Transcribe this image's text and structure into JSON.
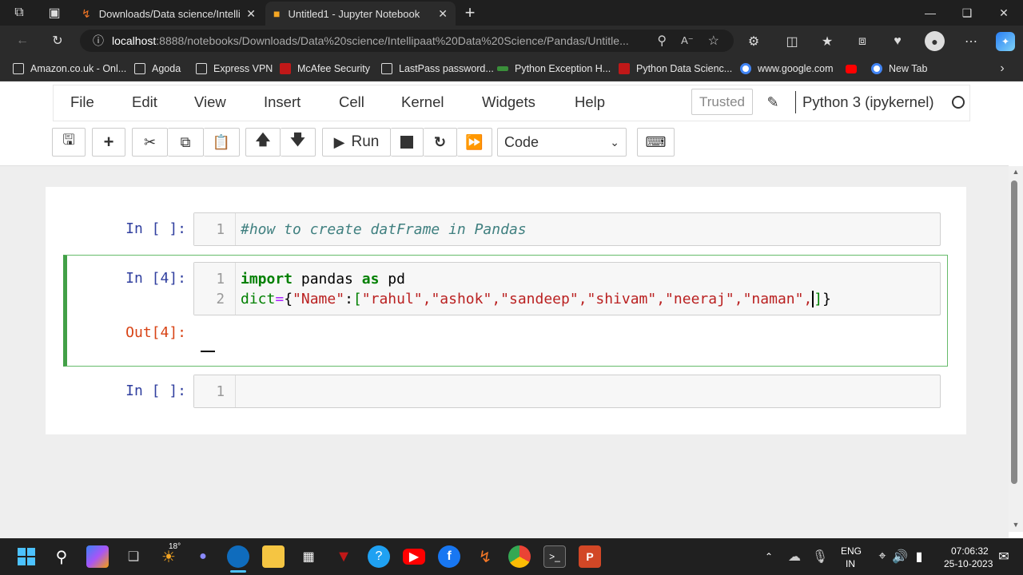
{
  "browser": {
    "tabs": [
      {
        "title": "Downloads/Data science/Intellipaat"
      },
      {
        "title": "Untitled1 - Jupyter Notebook"
      }
    ],
    "url": {
      "host": "localhost",
      "rest": ":8888/notebooks/Downloads/Data%20science/Intellipaat%20Data%20Science/Pandas/Untitle..."
    },
    "bookmarks": [
      {
        "label": "Amazon.co.uk - Onl...",
        "color": "#ffffff"
      },
      {
        "label": "Agoda",
        "color": "#ffffff"
      },
      {
        "label": "Express VPN",
        "color": "#ffffff"
      },
      {
        "label": "McAfee Security",
        "color": "#c01818"
      },
      {
        "label": "LastPass password...",
        "color": "#ffffff"
      },
      {
        "label": "Python Exception H...",
        "color": "#3a8f3a"
      },
      {
        "label": "Python Data Scienc...",
        "color": "#c01818"
      },
      {
        "label": "www.google.com",
        "color": "#4285f4"
      },
      {
        "label": "",
        "color": "#ff0000"
      },
      {
        "label": "New Tab",
        "color": "#4285f4"
      }
    ]
  },
  "jupyter": {
    "menu": [
      "File",
      "Edit",
      "View",
      "Insert",
      "Cell",
      "Kernel",
      "Widgets",
      "Help"
    ],
    "trusted": "Trusted",
    "kernel": "Python 3 (ipykernel)",
    "toolbar": {
      "run_label": "Run",
      "cell_type": "Code"
    }
  },
  "cells": {
    "c1": {
      "prompt": "In [ ]:",
      "line1": "1",
      "comment": "#how to create datFrame in Pandas"
    },
    "c2": {
      "prompt": "In [4]:",
      "out_prompt": "Out[4]:",
      "line1": "1",
      "line2": "2",
      "import_kw": "import",
      "pandas_txt": " pandas ",
      "as_kw": "as",
      "pd_txt": " pd",
      "dict_txt": "dict",
      "eq": "=",
      "brace_open": "{",
      "key": "\"Name\"",
      "colon": ":",
      "bracket_open": "[",
      "values": "\"rahul\",\"ashok\",\"sandeep\",\"shivam\",\"neeraj\",\"naman\",",
      "bracket_close": "]",
      "brace_close": "}"
    },
    "c3": {
      "prompt": "In [ ]:",
      "line1": "1"
    }
  },
  "taskbar": {
    "weather": "18°",
    "lang1": "ENG",
    "lang2": "IN",
    "time": "07:06:32",
    "date": "25-10-2023"
  }
}
